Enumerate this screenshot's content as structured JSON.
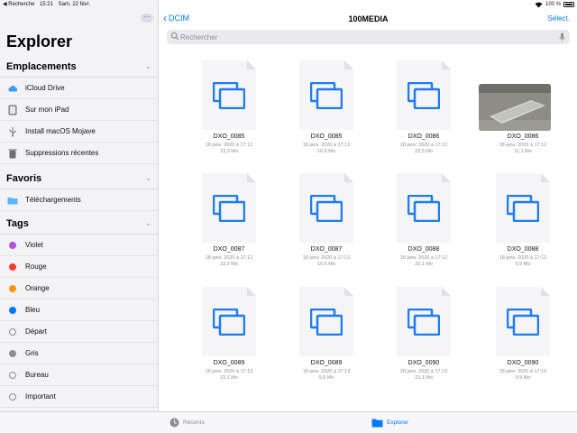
{
  "status": {
    "back": "◀ Recherche",
    "time": "15:21",
    "date": "Sam. 22 févr.",
    "battery": "100 %"
  },
  "sidebar": {
    "title": "Explorer",
    "locations": {
      "header": "Emplacements",
      "items": [
        {
          "label": "iCloud Drive",
          "icon": "cloud-icon"
        },
        {
          "label": "Sur mon iPad",
          "icon": "ipad-icon"
        },
        {
          "label": "Install macOS Mojave",
          "icon": "usb-icon"
        },
        {
          "label": "Suppressions récentes",
          "icon": "trash-icon"
        }
      ]
    },
    "favorites": {
      "header": "Favoris",
      "items": [
        {
          "label": "Téléchargements",
          "icon": "folder-icon"
        }
      ]
    },
    "tags": {
      "header": "Tags",
      "items": [
        {
          "label": "Violet",
          "color": "#af52de"
        },
        {
          "label": "Rouge",
          "color": "#ff3b30"
        },
        {
          "label": "Orange",
          "color": "#ff9500"
        },
        {
          "label": "Bleu",
          "color": "#007aff"
        },
        {
          "label": "Départ",
          "color": ""
        },
        {
          "label": "Gris",
          "color": "#8e8e93"
        },
        {
          "label": "Bureau",
          "color": ""
        },
        {
          "label": "Important",
          "color": ""
        }
      ]
    }
  },
  "nav": {
    "back_label": "DCIM",
    "title": "100MEDIA",
    "select_label": "Sélect."
  },
  "search": {
    "placeholder": "Rechercher"
  },
  "files": [
    {
      "name": "DXO_0085",
      "date": "18 janv. 2020 à 17:12",
      "size": "23,3 Mo",
      "kind": "document"
    },
    {
      "name": "DXO_0085",
      "date": "18 janv. 2020 à 17:12",
      "size": "10,6 Mo",
      "kind": "document"
    },
    {
      "name": "DXO_0086",
      "date": "18 janv. 2020 à 17:12",
      "size": "23,5 Mo",
      "kind": "document"
    },
    {
      "name": "DXO_0086",
      "date": "18 janv. 2020 à 17:12",
      "size": "11,1 Mo",
      "kind": "photo"
    },
    {
      "name": "DXO_0087",
      "date": "18 janv. 2020 à 17:12",
      "size": "23,2 Mo",
      "kind": "document"
    },
    {
      "name": "DXO_0087",
      "date": "18 janv. 2020 à 17:12",
      "size": "10,6 Mo",
      "kind": "document"
    },
    {
      "name": "DXO_0088",
      "date": "18 janv. 2020 à 17:12",
      "size": "23,1 Mo",
      "kind": "document"
    },
    {
      "name": "DXO_0088",
      "date": "18 janv. 2020 à 17:12",
      "size": "9,9 Mo",
      "kind": "document"
    },
    {
      "name": "DXO_0089",
      "date": "18 janv. 2020 à 17:13",
      "size": "23,1 Mo",
      "kind": "document"
    },
    {
      "name": "DXO_0089",
      "date": "18 janv. 2020 à 17:13",
      "size": "9,9 Mo",
      "kind": "document"
    },
    {
      "name": "DXO_0090",
      "date": "18 janv. 2020 à 17:13",
      "size": "23,1 Mo",
      "kind": "document"
    },
    {
      "name": "DXO_0090",
      "date": "18 janv. 2020 à 17:13",
      "size": "9,9 Mo",
      "kind": "document"
    }
  ],
  "tabbar": {
    "recents_label": "Récents",
    "explorer_label": "Explorer"
  },
  "colors": {
    "accent": "#007aff"
  }
}
